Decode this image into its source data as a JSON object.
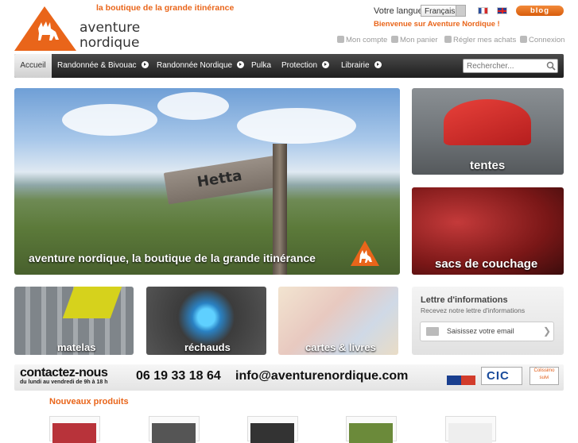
{
  "header": {
    "brand": {
      "line1": "aventure",
      "line2": "nordique"
    },
    "tagline": "la boutique de la grande itinérance",
    "language_label": "Votre langue :",
    "language_value": "Français",
    "blog_label": "blog",
    "welcome": "Bienvenue sur Aventure Nordique !",
    "account_links": [
      "Mon compte",
      "Mon panier",
      "Régler mes achats",
      "Connexion"
    ],
    "colors": {
      "accent": "#e9651a",
      "nav_dark": "#2b2b2b"
    }
  },
  "nav": {
    "items": [
      "Accueil",
      "Randonnée & Bivouac",
      "Randonnée Nordique",
      "Pulka",
      "Protection",
      "Librairie"
    ],
    "active": "Accueil",
    "search_placeholder": "Rechercher..."
  },
  "hero": {
    "caption": "aventure nordique, la boutique de la grande itinérance",
    "sign_text": "Hetta"
  },
  "categories": {
    "tents": "tentes",
    "sleeping_bags": "sacs de couchage",
    "mattresses": "matelas",
    "stoves": "réchauds",
    "maps_books": "cartes & livres"
  },
  "newsletter": {
    "title": "Lettre d'informations",
    "subtitle": "Recevez notre lettre d'informations",
    "input_label": "Saisissez votre email"
  },
  "contact": {
    "title": "contactez-nous",
    "hours": "du lundi au vendredi de 9h à 18 h",
    "phone": "06 19 33 18 64",
    "email": "info@aventurenordique.com",
    "bank": "CIC",
    "shipping": "Colissimo suivi"
  },
  "products": {
    "title": "Nouveaux produits"
  }
}
